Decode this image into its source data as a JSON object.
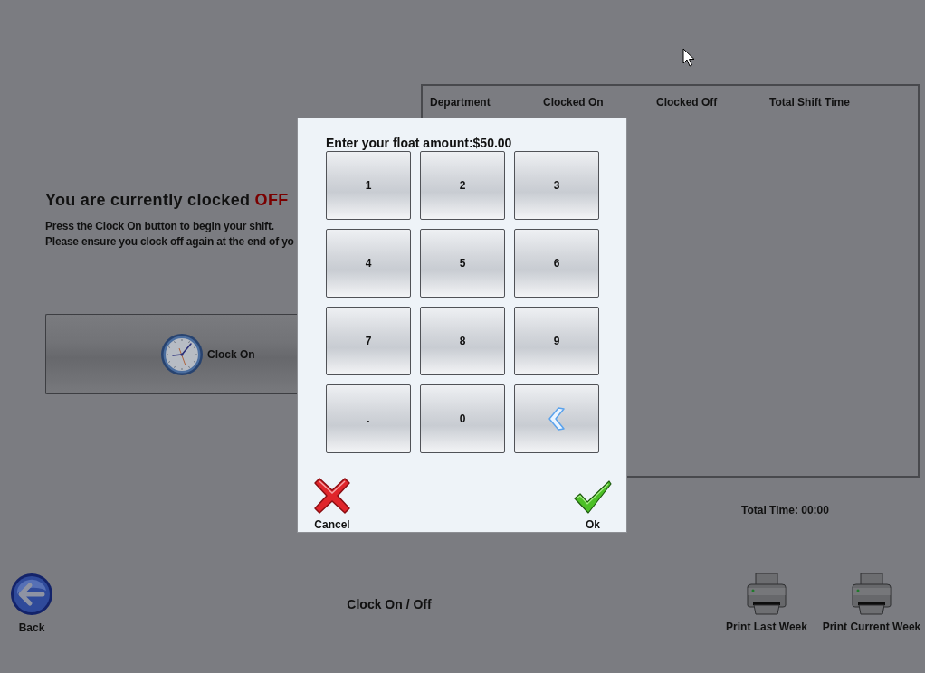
{
  "status": {
    "text": "You are currently clocked",
    "state_word": "OFF"
  },
  "instructions": [
    "Press the Clock On button to begin your shift.",
    "Please ensure you clock off again at the end of yo"
  ],
  "clock_button": {
    "label": "Clock On"
  },
  "table": {
    "columns": [
      "Department",
      "Clocked On",
      "Clocked Off",
      "Total Shift Time"
    ]
  },
  "total_time": "Total Time: 00:00",
  "footer": {
    "back": {
      "label": "Back"
    },
    "title": "Clock On / Off",
    "print_buttons": [
      {
        "label": "Print Last Week"
      },
      {
        "label": "Print Current Week"
      }
    ]
  },
  "dialog": {
    "prompt": "Enter your float amount:$50.00",
    "keys": [
      {
        "kind": "char",
        "label": "1"
      },
      {
        "kind": "char",
        "label": "2"
      },
      {
        "kind": "char",
        "label": "3"
      },
      {
        "kind": "char",
        "label": "4"
      },
      {
        "kind": "char",
        "label": "5"
      },
      {
        "kind": "char",
        "label": "6"
      },
      {
        "kind": "char",
        "label": "7"
      },
      {
        "kind": "char",
        "label": "8"
      },
      {
        "kind": "char",
        "label": "9"
      },
      {
        "kind": "char",
        "label": "."
      },
      {
        "kind": "char",
        "label": "0"
      },
      {
        "kind": "backspace"
      }
    ],
    "actions": [
      {
        "kind": "cancel",
        "label": "Cancel"
      },
      {
        "kind": "ok",
        "label": "Ok"
      }
    ]
  }
}
